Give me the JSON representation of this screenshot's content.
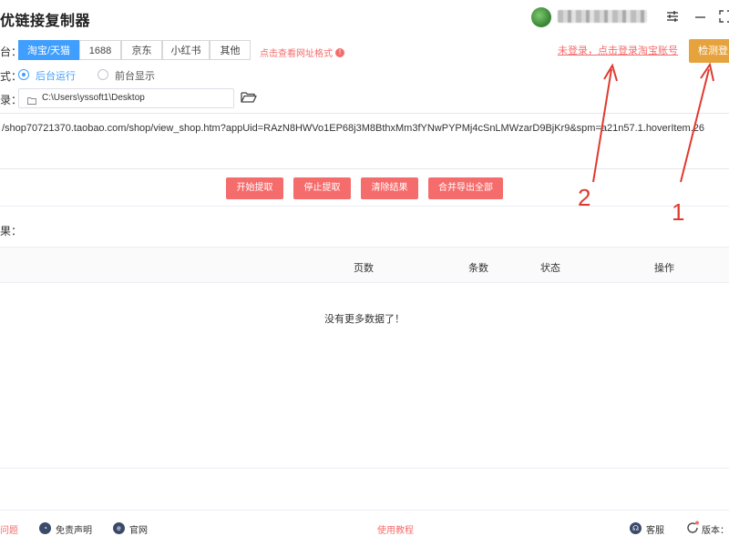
{
  "app": {
    "title": "优链接复制器"
  },
  "window": {
    "settings_icon": "sliders-icon",
    "minimize_icon": "minimize-icon",
    "maximize_icon": "maximize-icon"
  },
  "platform": {
    "label": "台：",
    "tabs": [
      {
        "label": "淘宝/天猫",
        "active": true
      },
      {
        "label": "1688",
        "active": false
      },
      {
        "label": "京东",
        "active": false
      },
      {
        "label": "小红书",
        "active": false
      },
      {
        "label": "其他",
        "active": false
      }
    ],
    "format_link": "点击查看网址格式",
    "info_icon": "!"
  },
  "account": {
    "login_link": "未登录，点击登录淘宝账号",
    "detect_button": "检测登"
  },
  "mode": {
    "label": "式：",
    "options": [
      {
        "label": "后台运行",
        "selected": true
      },
      {
        "label": "前台显示",
        "selected": false
      }
    ]
  },
  "directory": {
    "label": "录：",
    "path": "C:\\Users\\yssoft1\\Desktop",
    "folder_icon": "folder-open-icon"
  },
  "url_input": {
    "value": "/shop70721370.taobao.com/shop/view_shop.htm?appUid=RAzN8HWVo1EP68j3M8BthxMm3fYNwPYPMj4cSnLMWzarD9BjKr9&spm=a21n57.1.hoverItem.26"
  },
  "actions": {
    "start": "开始提取",
    "stop": "停止提取",
    "clear": "清除结果",
    "merge_export": "合并导出全部"
  },
  "results": {
    "label": "果：",
    "columns": [
      "页数",
      "条数",
      "状态",
      "操作"
    ],
    "empty_text": "没有更多数据了！"
  },
  "footer": {
    "problem": "问题",
    "disclaimer": "免责声明",
    "website": "官网",
    "tutorial": "使用教程",
    "service": "客服",
    "version": "版本："
  },
  "annotations": {
    "one": "1",
    "two": "2"
  },
  "colors": {
    "primary": "#409eff",
    "danger": "#f56c6c",
    "warning": "#e6a23c",
    "annotation": "#e03a2e"
  }
}
